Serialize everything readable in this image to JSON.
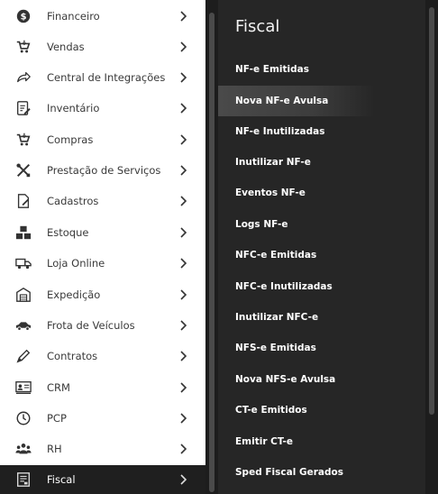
{
  "left_menu": {
    "items": [
      {
        "label": "Financeiro",
        "icon": "dollar-icon"
      },
      {
        "label": "Vendas",
        "icon": "cart-icon"
      },
      {
        "label": "Central de Integrações",
        "icon": "share-arrow-icon"
      },
      {
        "label": "Inventário",
        "icon": "clipboard-edit-icon"
      },
      {
        "label": "Compras",
        "icon": "cart-icon"
      },
      {
        "label": "Prestação de Serviços",
        "icon": "tools-icon"
      },
      {
        "label": "Cadastros",
        "icon": "edit-document-icon"
      },
      {
        "label": "Estoque",
        "icon": "boxes-icon"
      },
      {
        "label": "Loja Online",
        "icon": "truck-icon"
      },
      {
        "label": "Expedição",
        "icon": "warehouse-icon"
      },
      {
        "label": "Frota de Veículos",
        "icon": "car-icon"
      },
      {
        "label": "Contratos",
        "icon": "pen-icon"
      },
      {
        "label": "CRM",
        "icon": "id-card-icon"
      },
      {
        "label": "PCP",
        "icon": "clock-icon"
      },
      {
        "label": "RH",
        "icon": "users-icon"
      },
      {
        "label": "Fiscal",
        "icon": "receipt-icon",
        "active": true
      }
    ]
  },
  "submenu": {
    "title": "Fiscal",
    "items": [
      {
        "label": "NF-e Emitidas"
      },
      {
        "label": "Nova NF-e Avulsa",
        "hover": true
      },
      {
        "label": "NF-e Inutilizadas"
      },
      {
        "label": "Inutilizar NF-e"
      },
      {
        "label": "Eventos NF-e"
      },
      {
        "label": "Logs NF-e"
      },
      {
        "label": "NFC-e Emitidas"
      },
      {
        "label": "NFC-e Inutilizadas"
      },
      {
        "label": "Inutilizar NFC-e"
      },
      {
        "label": "NFS-e Emitidas"
      },
      {
        "label": "Nova NFS-e Avulsa"
      },
      {
        "label": "CT-e Emitidos"
      },
      {
        "label": "Emitir CT-e"
      },
      {
        "label": "Sped Fiscal Gerados"
      }
    ]
  },
  "colors": {
    "menu_bg": "#ffffff",
    "active_bg": "#1f1f1f",
    "panel_bg": "#262626",
    "icon_color": "#333333"
  }
}
